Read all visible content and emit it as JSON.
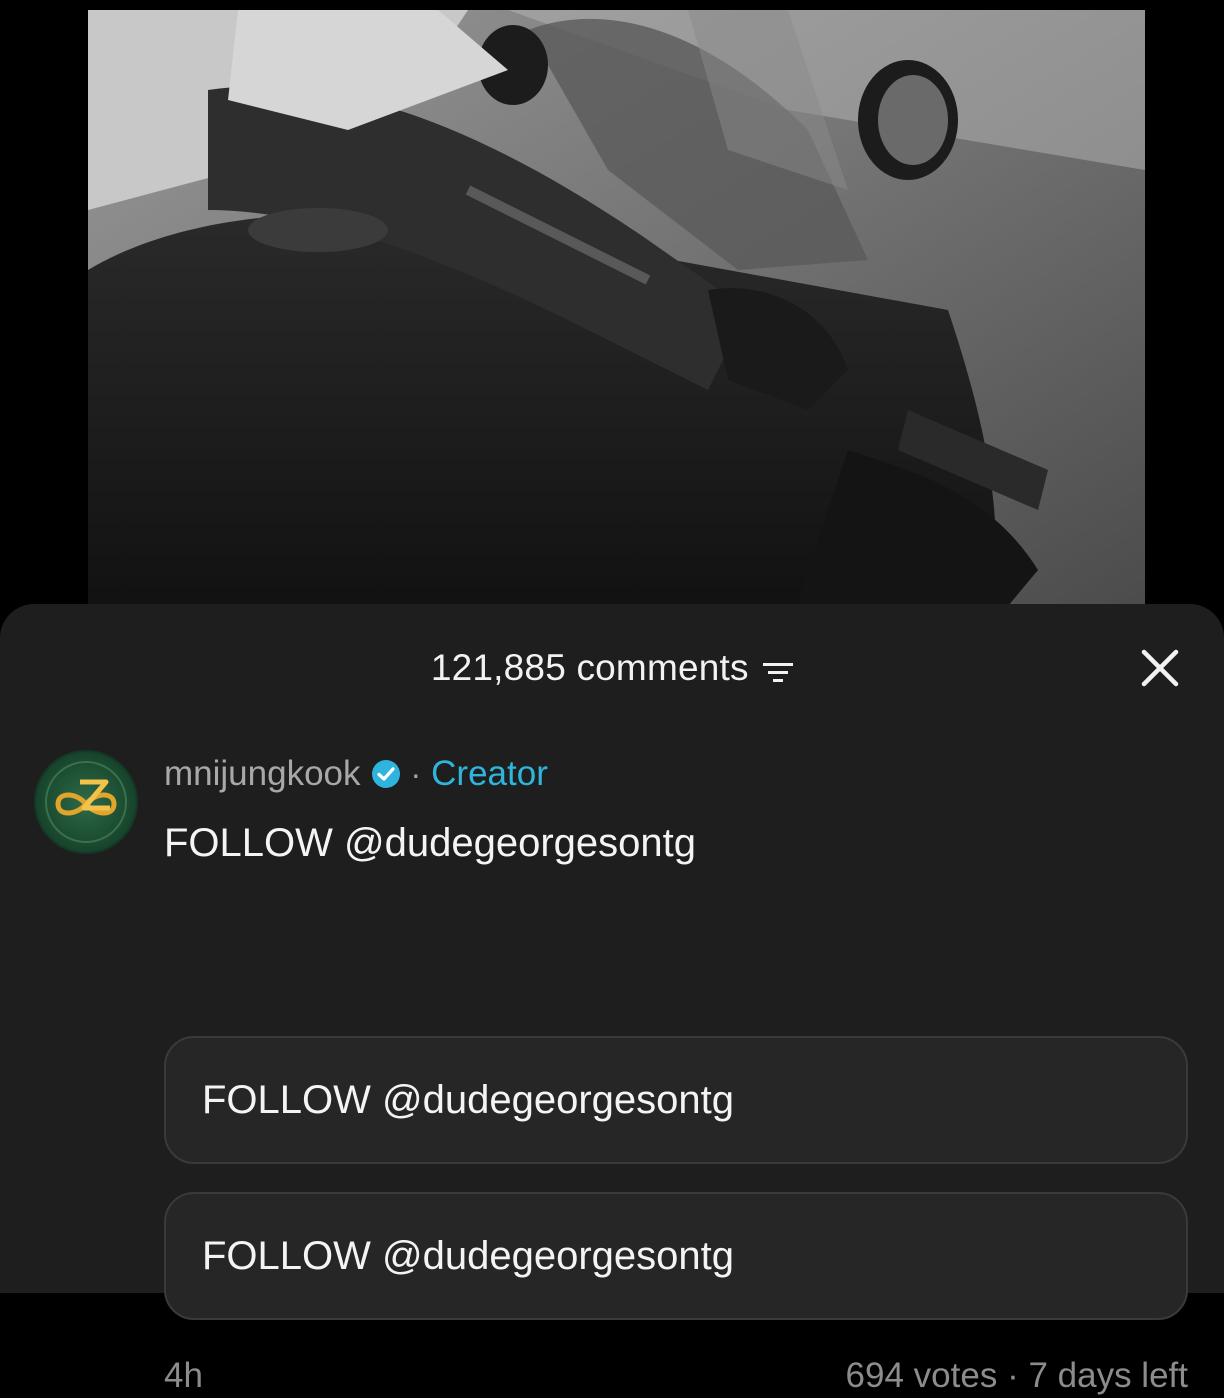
{
  "video": {
    "description_visible": false
  },
  "comments_sheet": {
    "count_label": "121,885 comments",
    "filter_icon": "filter-icon",
    "close_icon": "close-icon"
  },
  "comment": {
    "username": "mnijungkook",
    "verified_icon": "verified-check-icon",
    "separator": "·",
    "role": "Creator",
    "text": "FOLLOW @dudegeorgesontg",
    "poll": {
      "options": [
        {
          "label": "FOLLOW @dudegeorgesontg"
        },
        {
          "label": "FOLLOW @dudegeorgesontg"
        }
      ],
      "votes": "694 votes",
      "separator": "·",
      "time_left": "7 days left"
    },
    "timestamp": "4h"
  },
  "colors": {
    "background": "#000000",
    "sheet": "#1e1e1e",
    "creator_accent": "#2fb5dd",
    "verified": "#2fb5dd",
    "muted_text": "#a8a8a8"
  }
}
